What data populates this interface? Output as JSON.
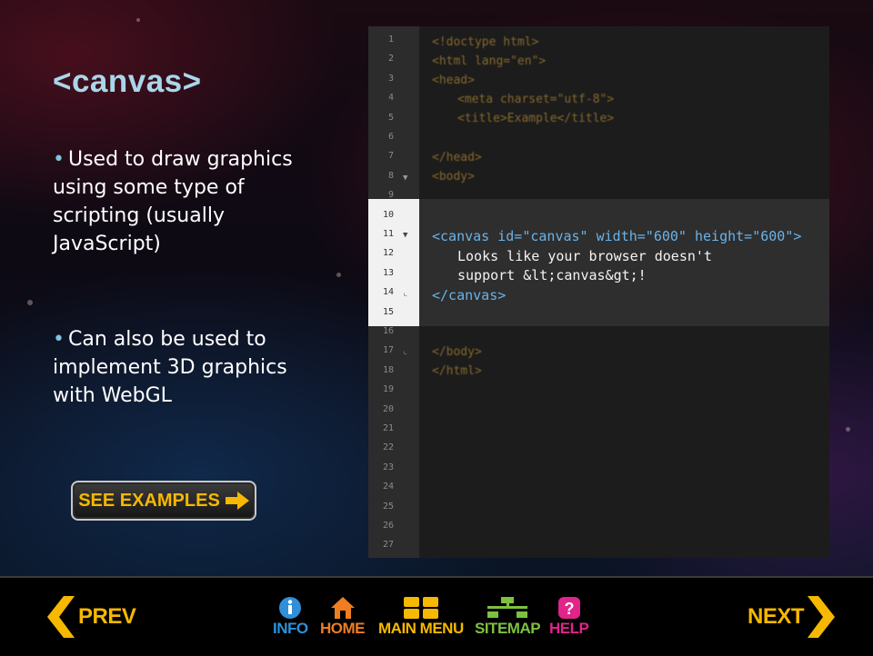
{
  "slide": {
    "title": "<canvas>",
    "bullets": [
      "Used to draw graphics using some type of scripting (usually JavaScript)",
      "Can also be used to implement 3D graphics with WebGL"
    ],
    "bullet_marker": "•",
    "examples_button": "SEE EXAMPLES"
  },
  "editor": {
    "line_numbers": [
      "1",
      "2",
      "3",
      "4",
      "5",
      "6",
      "7",
      "8",
      "9",
      "10",
      "11",
      "12",
      "13",
      "14",
      "15",
      "16",
      "17",
      "18",
      "19",
      "20",
      "21",
      "22",
      "23",
      "24",
      "25",
      "26",
      "27"
    ],
    "lines": {
      "l1": "<!doctype html>",
      "l2": "<html lang=\"en\">",
      "l3": "<head>",
      "l4": "<meta charset=\"utf-8\">",
      "l5": "<title>Example</title>",
      "l7": "</head>",
      "l8": "<body>",
      "l11": "<canvas id=\"canvas\" width=\"600\" height=\"600\">",
      "l12": "Looks like your browser doesn't",
      "l13": "support &lt;canvas&gt;!",
      "l14": "</canvas>",
      "l17": "</body>",
      "l18": "</html>"
    }
  },
  "nav": {
    "prev": "PREV",
    "info": "INFO",
    "home": "HOME",
    "main_menu": "MAIN MENU",
    "sitemap": "SITEMAP",
    "help": "HELP",
    "next": "NEXT"
  },
  "colors": {
    "title": "#a9d6ea",
    "accent_yellow": "#f6b800",
    "info_blue": "#2f8fd8",
    "home_orange": "#ef7d22",
    "sitemap_green": "#7dc13f",
    "help_magenta": "#e0248a"
  }
}
